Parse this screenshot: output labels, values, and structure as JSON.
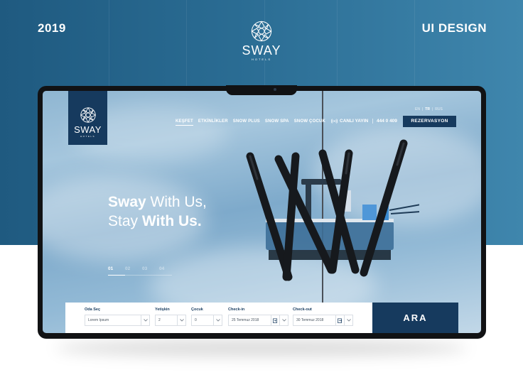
{
  "presentation": {
    "year": "2019",
    "tag": "UI DESIGN",
    "brand_name": "SWAY",
    "brand_sub": "HOTELS"
  },
  "site": {
    "logo": {
      "name": "SWAY",
      "sub": "HOTELS"
    },
    "nav": [
      {
        "label": "KEŞFET",
        "active": true
      },
      {
        "label": "ETKİNLİKLER",
        "active": false
      },
      {
        "label": "SNOW PLUS",
        "active": false
      },
      {
        "label": "SNOW SPA",
        "active": false
      },
      {
        "label": "SNOW ÇOCUK",
        "active": false
      }
    ],
    "languages": [
      "EN",
      "TR",
      "RUS"
    ],
    "language_active": "TR",
    "live_label": "CANLI YAYIN",
    "phone": "444 0 409",
    "reserve_label": "REZERVASYON",
    "hero": {
      "line1_bold": "Sway",
      "line1_rest": " With Us,",
      "line2_pre": "Stay ",
      "line2_bold": "With Us."
    },
    "slides": [
      "01",
      "02",
      "03",
      "04"
    ],
    "slide_active": "01",
    "slide_progress": 0.27,
    "booking": {
      "room": {
        "label": "Oda Seç",
        "value": "Lorem Ipsum"
      },
      "adult": {
        "label": "Yetişkin",
        "value": "2"
      },
      "child": {
        "label": "Çocuk",
        "value": "0"
      },
      "checkin": {
        "label": "Check-in",
        "value": "25 Temmuz 2018"
      },
      "checkout": {
        "label": "Check-out",
        "value": "30 Temmuz 2018"
      },
      "submit": "ARA"
    }
  },
  "colors": {
    "brand_navy": "#163a5e",
    "bg_blue": "#2a6c93",
    "sky": "#8fb6d2"
  },
  "icons": [
    "logo-mandala-icon",
    "live-broadcast-icon",
    "chevron-down-icon",
    "calendar-in-icon",
    "calendar-out-icon"
  ]
}
